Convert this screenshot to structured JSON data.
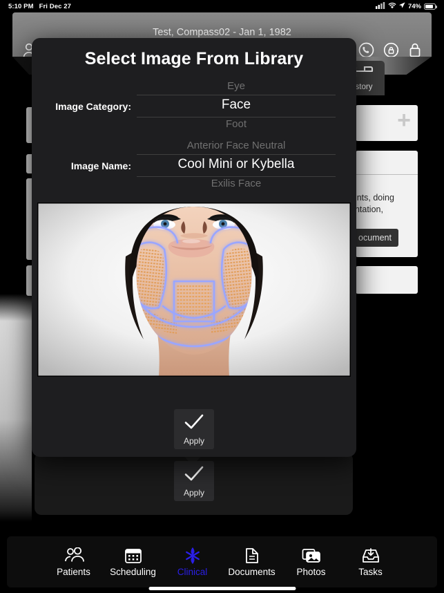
{
  "status_bar": {
    "time": "5:10 PM",
    "date": "Fri Dec 27",
    "battery_percent": "74%",
    "cellular_icon": "cellular-bars-icon",
    "wifi_icon": "wifi-icon",
    "location_icon": "location-arrow-icon",
    "battery_icon": "battery-icon"
  },
  "app_bar": {
    "patient_title": "Test, Compass02  -  Jan 1, 1982",
    "left_icons": [
      "person-icon",
      "chat-bubble-icon",
      "share-up-arrow-icon",
      "close-x-icon"
    ],
    "right_icons": [
      "refresh-icon",
      "help-circle-icon",
      "phone-icon",
      "lock-rotate-icon",
      "lock-icon"
    ]
  },
  "background": {
    "history_tab": {
      "label": "story",
      "icon": "bed-icon"
    },
    "add_card_plus": "+",
    "note_line_1": "aints, doing",
    "note_line_2": "entation,",
    "document_chip": "ocument"
  },
  "modal": {
    "title": "Select Image From Library",
    "fields": [
      {
        "label": "Image Category:",
        "previous": "Eye",
        "selected": "Face",
        "next": "Foot"
      },
      {
        "label": "Image Name:",
        "previous": "Anterior Face Neutral",
        "selected": "Cool Mini or Kybella",
        "next": "Exilis Face"
      }
    ],
    "preview": {
      "alt": "Cool Mini or Kybella treatment area illustration on a face, lower face and jawline marked with glowing blue outlines and orange treatment grids"
    },
    "apply_button": {
      "label": "Apply",
      "icon": "checkmark-icon"
    }
  },
  "sheet": {
    "apply_button": {
      "label": "Apply",
      "icon": "checkmark-icon"
    }
  },
  "tab_bar": {
    "active": "Clinical",
    "active_color": "#2b1fe8",
    "items": [
      {
        "label": "Patients",
        "icon": "people-icon"
      },
      {
        "label": "Scheduling",
        "icon": "calendar-icon"
      },
      {
        "label": "Clinical",
        "icon": "medical-star-of-life-icon"
      },
      {
        "label": "Documents",
        "icon": "document-icon"
      },
      {
        "label": "Photos",
        "icon": "photos-stack-icon"
      },
      {
        "label": "Tasks",
        "icon": "inbox-download-icon"
      }
    ]
  },
  "colors": {
    "modal_bg": "#1e1e20",
    "appbar_bg": "#808080",
    "tabbar_bg": "#0d0d0d",
    "accent": "#2b1fe8"
  }
}
